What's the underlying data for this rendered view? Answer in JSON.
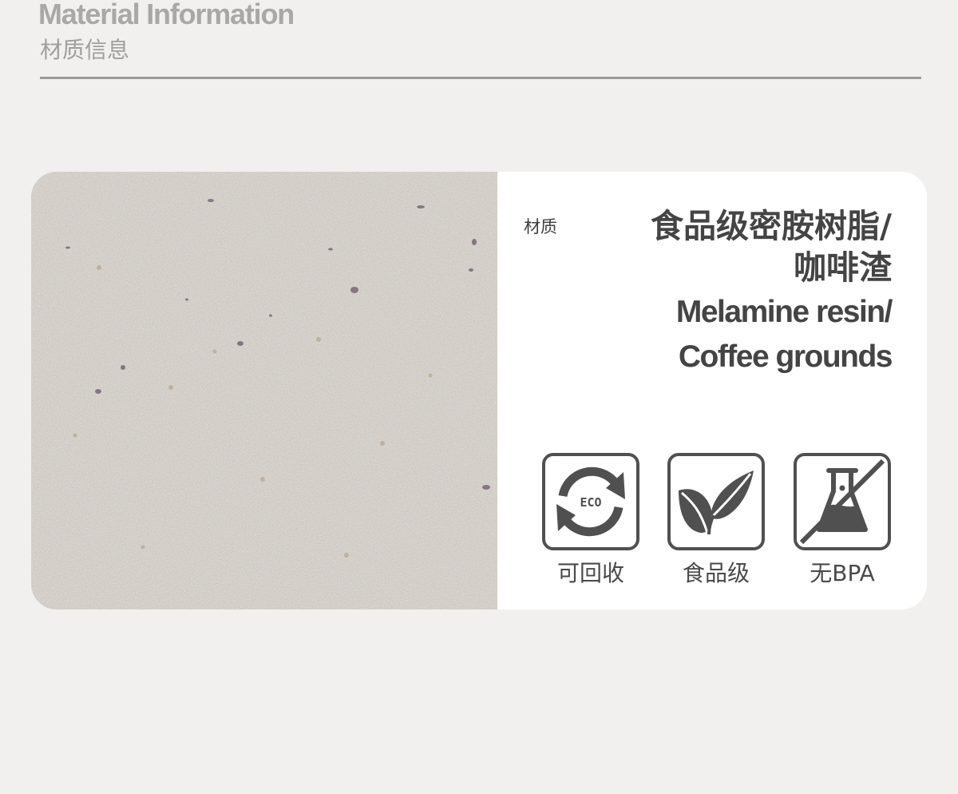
{
  "header": {
    "title_en": "Material Information",
    "title_cn": "材质信息"
  },
  "material": {
    "label": "材质",
    "value_cn_line1": "食品级密胺树脂/",
    "value_cn_line2": "咖啡渣",
    "value_en_line1": "Melamine resin/",
    "value_en_line2": "Coffee grounds"
  },
  "badges": [
    {
      "icon": "eco-recycle-icon",
      "text": "ECO",
      "caption": "可回收"
    },
    {
      "icon": "leaf-icon",
      "caption": "食品级"
    },
    {
      "icon": "no-bpa-flask-icon",
      "caption": "无BPA"
    }
  ],
  "colors": {
    "background": "#f1f0ee",
    "card": "#ffffff",
    "texture": "#d4cec7",
    "icon": "#505050",
    "text_dark": "#444444",
    "text_muted": "#a9a8a6"
  }
}
